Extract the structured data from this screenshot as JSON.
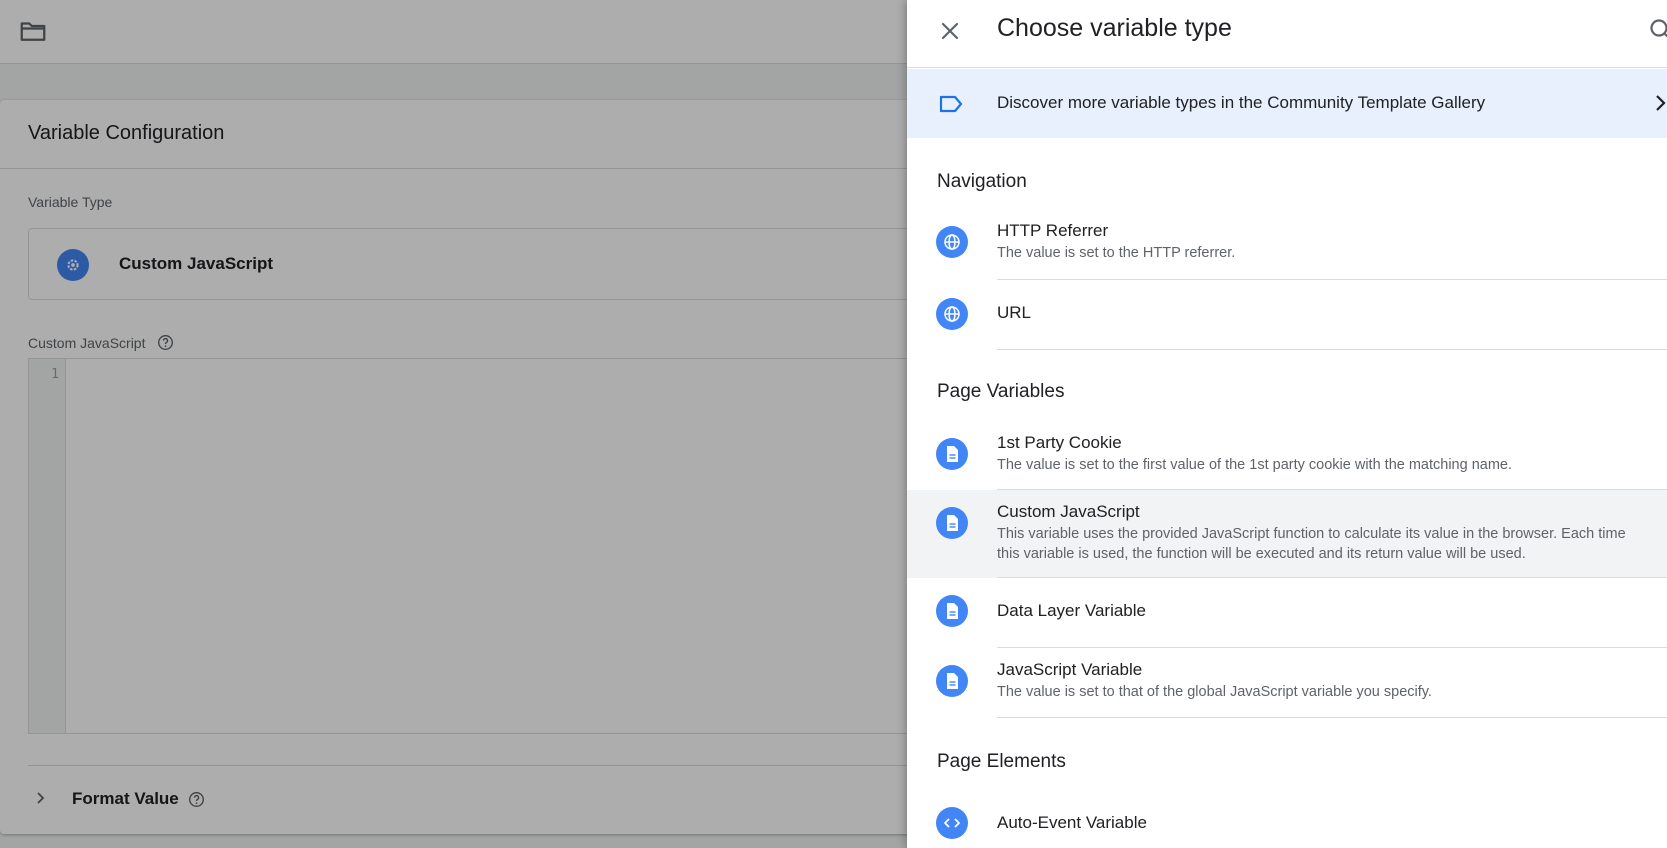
{
  "background": {
    "card_title": "Variable Configuration",
    "variable_type_label": "Variable Type",
    "variable_type_value": "Custom JavaScript",
    "custom_js_label": "Custom JavaScript",
    "code_line_number": "1",
    "format_value_label": "Format Value"
  },
  "drawer": {
    "title": "Choose variable type",
    "discover_text": "Discover more variable types in the Community Template Gallery",
    "sections": {
      "navigation": "Navigation",
      "page_variables": "Page Variables",
      "page_elements": "Page Elements"
    },
    "items": {
      "http_referrer": {
        "name": "HTTP Referrer",
        "desc": "The value is set to the HTTP referrer.",
        "icon": "globe-icon"
      },
      "url": {
        "name": "URL",
        "icon": "globe-icon"
      },
      "first_party_cookie": {
        "name": "1st Party Cookie",
        "desc": "The value is set to the first value of the 1st party cookie with the matching name.",
        "icon": "document-icon"
      },
      "custom_javascript": {
        "name": "Custom JavaScript",
        "desc": "This variable uses the provided JavaScript function to calculate its value in the browser. Each time this variable is used, the function will be executed and its return value will be used.",
        "icon": "document-icon",
        "selected": true
      },
      "data_layer_variable": {
        "name": "Data Layer Variable",
        "icon": "document-icon"
      },
      "javascript_variable": {
        "name": "JavaScript Variable",
        "desc": "The value is set to that of the global JavaScript variable you specify.",
        "icon": "document-icon"
      },
      "auto_event_variable": {
        "name": "Auto-Event Variable",
        "icon": "code-icon"
      }
    }
  },
  "colors": {
    "accent": "#4285f4",
    "discover_bg": "#e8f0fe",
    "selected_bg": "#f1f3f4",
    "overlay": "rgba(0,0,0,0.32)"
  }
}
